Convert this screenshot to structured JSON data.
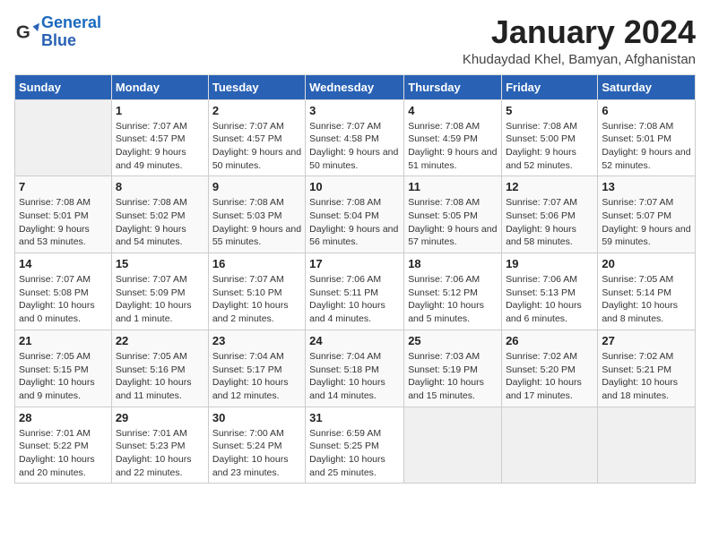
{
  "logo": {
    "text_general": "General",
    "text_blue": "Blue"
  },
  "title": "January 2024",
  "location": "Khudaydad Khel, Bamyan, Afghanistan",
  "days_header": [
    "Sunday",
    "Monday",
    "Tuesday",
    "Wednesday",
    "Thursday",
    "Friday",
    "Saturday"
  ],
  "weeks": [
    [
      {
        "day": "",
        "sunrise": "",
        "sunset": "",
        "daylight": "",
        "empty": true
      },
      {
        "day": "1",
        "sunrise": "Sunrise: 7:07 AM",
        "sunset": "Sunset: 4:57 PM",
        "daylight": "Daylight: 9 hours and 49 minutes."
      },
      {
        "day": "2",
        "sunrise": "Sunrise: 7:07 AM",
        "sunset": "Sunset: 4:57 PM",
        "daylight": "Daylight: 9 hours and 50 minutes."
      },
      {
        "day": "3",
        "sunrise": "Sunrise: 7:07 AM",
        "sunset": "Sunset: 4:58 PM",
        "daylight": "Daylight: 9 hours and 50 minutes."
      },
      {
        "day": "4",
        "sunrise": "Sunrise: 7:08 AM",
        "sunset": "Sunset: 4:59 PM",
        "daylight": "Daylight: 9 hours and 51 minutes."
      },
      {
        "day": "5",
        "sunrise": "Sunrise: 7:08 AM",
        "sunset": "Sunset: 5:00 PM",
        "daylight": "Daylight: 9 hours and 52 minutes."
      },
      {
        "day": "6",
        "sunrise": "Sunrise: 7:08 AM",
        "sunset": "Sunset: 5:01 PM",
        "daylight": "Daylight: 9 hours and 52 minutes."
      }
    ],
    [
      {
        "day": "7",
        "sunrise": "Sunrise: 7:08 AM",
        "sunset": "Sunset: 5:01 PM",
        "daylight": "Daylight: 9 hours and 53 minutes."
      },
      {
        "day": "8",
        "sunrise": "Sunrise: 7:08 AM",
        "sunset": "Sunset: 5:02 PM",
        "daylight": "Daylight: 9 hours and 54 minutes."
      },
      {
        "day": "9",
        "sunrise": "Sunrise: 7:08 AM",
        "sunset": "Sunset: 5:03 PM",
        "daylight": "Daylight: 9 hours and 55 minutes."
      },
      {
        "day": "10",
        "sunrise": "Sunrise: 7:08 AM",
        "sunset": "Sunset: 5:04 PM",
        "daylight": "Daylight: 9 hours and 56 minutes."
      },
      {
        "day": "11",
        "sunrise": "Sunrise: 7:08 AM",
        "sunset": "Sunset: 5:05 PM",
        "daylight": "Daylight: 9 hours and 57 minutes."
      },
      {
        "day": "12",
        "sunrise": "Sunrise: 7:07 AM",
        "sunset": "Sunset: 5:06 PM",
        "daylight": "Daylight: 9 hours and 58 minutes."
      },
      {
        "day": "13",
        "sunrise": "Sunrise: 7:07 AM",
        "sunset": "Sunset: 5:07 PM",
        "daylight": "Daylight: 9 hours and 59 minutes."
      }
    ],
    [
      {
        "day": "14",
        "sunrise": "Sunrise: 7:07 AM",
        "sunset": "Sunset: 5:08 PM",
        "daylight": "Daylight: 10 hours and 0 minutes."
      },
      {
        "day": "15",
        "sunrise": "Sunrise: 7:07 AM",
        "sunset": "Sunset: 5:09 PM",
        "daylight": "Daylight: 10 hours and 1 minute."
      },
      {
        "day": "16",
        "sunrise": "Sunrise: 7:07 AM",
        "sunset": "Sunset: 5:10 PM",
        "daylight": "Daylight: 10 hours and 2 minutes."
      },
      {
        "day": "17",
        "sunrise": "Sunrise: 7:06 AM",
        "sunset": "Sunset: 5:11 PM",
        "daylight": "Daylight: 10 hours and 4 minutes."
      },
      {
        "day": "18",
        "sunrise": "Sunrise: 7:06 AM",
        "sunset": "Sunset: 5:12 PM",
        "daylight": "Daylight: 10 hours and 5 minutes."
      },
      {
        "day": "19",
        "sunrise": "Sunrise: 7:06 AM",
        "sunset": "Sunset: 5:13 PM",
        "daylight": "Daylight: 10 hours and 6 minutes."
      },
      {
        "day": "20",
        "sunrise": "Sunrise: 7:05 AM",
        "sunset": "Sunset: 5:14 PM",
        "daylight": "Daylight: 10 hours and 8 minutes."
      }
    ],
    [
      {
        "day": "21",
        "sunrise": "Sunrise: 7:05 AM",
        "sunset": "Sunset: 5:15 PM",
        "daylight": "Daylight: 10 hours and 9 minutes."
      },
      {
        "day": "22",
        "sunrise": "Sunrise: 7:05 AM",
        "sunset": "Sunset: 5:16 PM",
        "daylight": "Daylight: 10 hours and 11 minutes."
      },
      {
        "day": "23",
        "sunrise": "Sunrise: 7:04 AM",
        "sunset": "Sunset: 5:17 PM",
        "daylight": "Daylight: 10 hours and 12 minutes."
      },
      {
        "day": "24",
        "sunrise": "Sunrise: 7:04 AM",
        "sunset": "Sunset: 5:18 PM",
        "daylight": "Daylight: 10 hours and 14 minutes."
      },
      {
        "day": "25",
        "sunrise": "Sunrise: 7:03 AM",
        "sunset": "Sunset: 5:19 PM",
        "daylight": "Daylight: 10 hours and 15 minutes."
      },
      {
        "day": "26",
        "sunrise": "Sunrise: 7:02 AM",
        "sunset": "Sunset: 5:20 PM",
        "daylight": "Daylight: 10 hours and 17 minutes."
      },
      {
        "day": "27",
        "sunrise": "Sunrise: 7:02 AM",
        "sunset": "Sunset: 5:21 PM",
        "daylight": "Daylight: 10 hours and 18 minutes."
      }
    ],
    [
      {
        "day": "28",
        "sunrise": "Sunrise: 7:01 AM",
        "sunset": "Sunset: 5:22 PM",
        "daylight": "Daylight: 10 hours and 20 minutes."
      },
      {
        "day": "29",
        "sunrise": "Sunrise: 7:01 AM",
        "sunset": "Sunset: 5:23 PM",
        "daylight": "Daylight: 10 hours and 22 minutes."
      },
      {
        "day": "30",
        "sunrise": "Sunrise: 7:00 AM",
        "sunset": "Sunset: 5:24 PM",
        "daylight": "Daylight: 10 hours and 23 minutes."
      },
      {
        "day": "31",
        "sunrise": "Sunrise: 6:59 AM",
        "sunset": "Sunset: 5:25 PM",
        "daylight": "Daylight: 10 hours and 25 minutes."
      },
      {
        "day": "",
        "sunrise": "",
        "sunset": "",
        "daylight": "",
        "empty": true
      },
      {
        "day": "",
        "sunrise": "",
        "sunset": "",
        "daylight": "",
        "empty": true
      },
      {
        "day": "",
        "sunrise": "",
        "sunset": "",
        "daylight": "",
        "empty": true
      }
    ]
  ]
}
